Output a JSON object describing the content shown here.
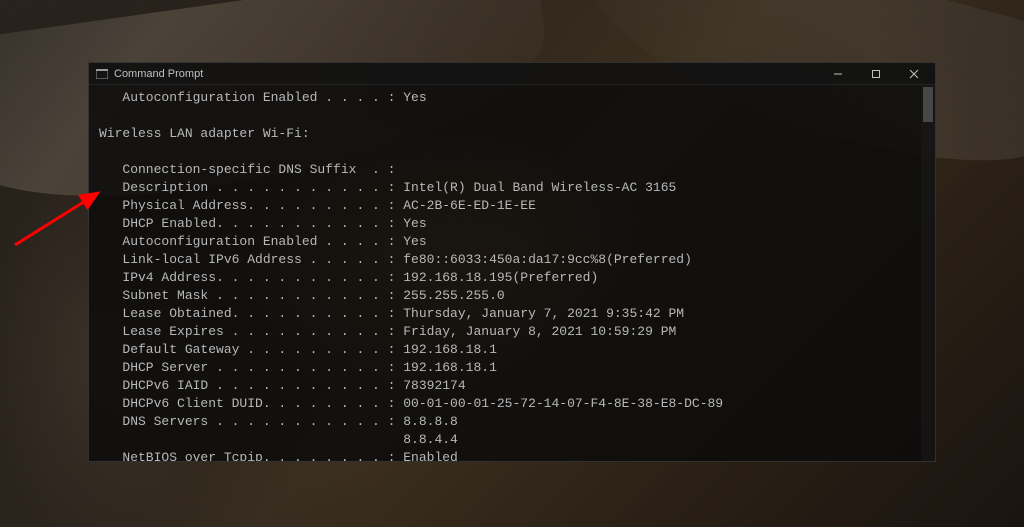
{
  "titlebar": {
    "title": "Command Prompt"
  },
  "terminal": {
    "line1": "   Autoconfiguration Enabled . . . . : Yes",
    "line2": "",
    "line3": "Wireless LAN adapter Wi-Fi:",
    "line4": "",
    "line5": "   Connection-specific DNS Suffix  . :",
    "line6": "   Description . . . . . . . . . . . : Intel(R) Dual Band Wireless-AC 3165",
    "line7": "   Physical Address. . . . . . . . . : AC-2B-6E-ED-1E-EE",
    "line8": "   DHCP Enabled. . . . . . . . . . . : Yes",
    "line9": "   Autoconfiguration Enabled . . . . : Yes",
    "line10": "   Link-local IPv6 Address . . . . . : fe80::6033:450a:da17:9cc%8(Preferred)",
    "line11": "   IPv4 Address. . . . . . . . . . . : 192.168.18.195(Preferred)",
    "line12": "   Subnet Mask . . . . . . . . . . . : 255.255.255.0",
    "line13": "   Lease Obtained. . . . . . . . . . : Thursday, January 7, 2021 9:35:42 PM",
    "line14": "   Lease Expires . . . . . . . . . . : Friday, January 8, 2021 10:59:29 PM",
    "line15": "   Default Gateway . . . . . . . . . : 192.168.18.1",
    "line16": "   DHCP Server . . . . . . . . . . . : 192.168.18.1",
    "line17": "   DHCPv6 IAID . . . . . . . . . . . : 78392174",
    "line18": "   DHCPv6 Client DUID. . . . . . . . : 00-01-00-01-25-72-14-07-F4-8E-38-E8-DC-89",
    "line19": "   DNS Servers . . . . . . . . . . . : 8.8.8.8",
    "line20": "                                       8.8.4.4",
    "line21": "   NetBIOS over Tcpip. . . . . . . . : Enabled"
  }
}
